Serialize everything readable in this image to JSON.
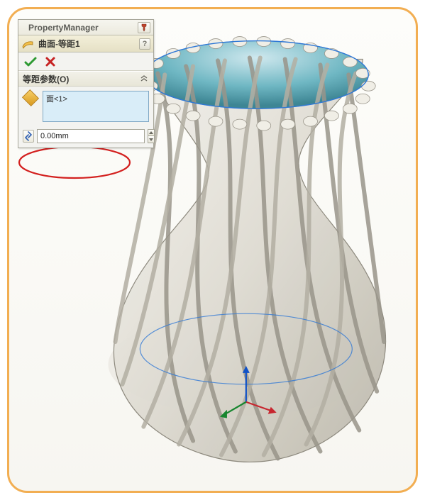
{
  "panel": {
    "title": "PropertyManager",
    "feature_title": "曲面-等距1",
    "help_label": "?",
    "section_title": "等距参数(O)",
    "selection_items": [
      "面<1>"
    ],
    "distance_value": "0.00mm"
  },
  "icons": {
    "pin": "pin-icon",
    "feature": "surface-offset-icon",
    "ok": "check-icon",
    "cancel": "x-icon",
    "chevron": "chevron-up-icon",
    "face_select": "face-select-icon",
    "distance": "reverse-direction-icon",
    "spin_up": "spin-up-icon",
    "spin_down": "spin-down-icon"
  }
}
